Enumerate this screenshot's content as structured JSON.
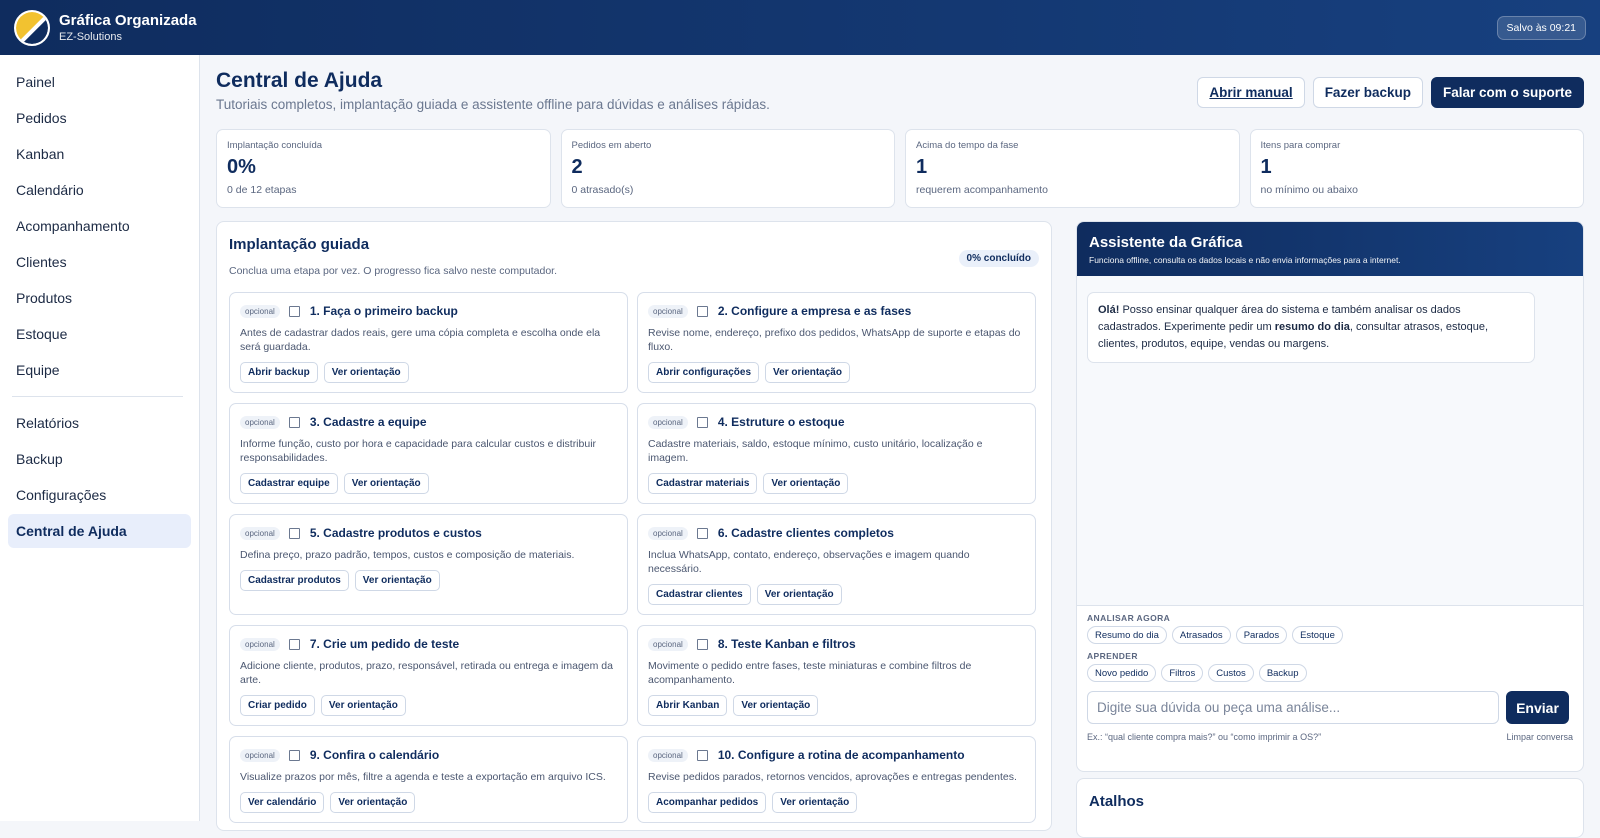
{
  "app": {
    "title": "Gráfica Organizada",
    "subtitle": "EZ-Solutions",
    "saved": "Salvo às 09:21"
  },
  "sidebar": {
    "items": [
      {
        "label": "Painel"
      },
      {
        "label": "Pedidos"
      },
      {
        "label": "Kanban"
      },
      {
        "label": "Calendário"
      },
      {
        "label": "Acompanhamento"
      },
      {
        "label": "Clientes"
      },
      {
        "label": "Produtos"
      },
      {
        "label": "Estoque"
      },
      {
        "label": "Equipe"
      },
      {
        "label": "Relatórios"
      },
      {
        "label": "Backup"
      },
      {
        "label": "Configurações"
      },
      {
        "label": "Central de Ajuda"
      }
    ]
  },
  "page": {
    "title": "Central de Ajuda",
    "subtitle": "Tutoriais completos, implantação guiada e assistente offline para dúvidas e análises rápidas.",
    "actions": {
      "manual": "Abrir manual",
      "backup": "Fazer backup",
      "support": "Falar com o suporte"
    }
  },
  "stats": [
    {
      "label": "Implantação concluída",
      "value": "0%",
      "note": "0 de 12 etapas"
    },
    {
      "label": "Pedidos em aberto",
      "value": "2",
      "note": "0 atrasado(s)"
    },
    {
      "label": "Acima do tempo da fase",
      "value": "1",
      "note": "requerem acompanhamento"
    },
    {
      "label": "Itens para comprar",
      "value": "1",
      "note": "no mínimo ou abaixo"
    }
  ],
  "guided": {
    "title": "Implantação guiada",
    "subtitle": "Conclua uma etapa por vez. O progresso fica salvo neste computador.",
    "progress": "0% concluído",
    "tag": "opcional",
    "steps": [
      {
        "title": "1. Faça o primeiro backup",
        "desc": "Antes de cadastrar dados reais, gere uma cópia completa e escolha onde ela será guardada.",
        "action": "Abrir backup",
        "guide": "Ver orientação"
      },
      {
        "title": "2. Configure a empresa e as fases",
        "desc": "Revise nome, endereço, prefixo dos pedidos, WhatsApp de suporte e etapas do fluxo.",
        "action": "Abrir configurações",
        "guide": "Ver orientação"
      },
      {
        "title": "3. Cadastre a equipe",
        "desc": "Informe função, custo por hora e capacidade para calcular custos e distribuir responsabilidades.",
        "action": "Cadastrar equipe",
        "guide": "Ver orientação"
      },
      {
        "title": "4. Estruture o estoque",
        "desc": "Cadastre materiais, saldo, estoque mínimo, custo unitário, localização e imagem.",
        "action": "Cadastrar materiais",
        "guide": "Ver orientação"
      },
      {
        "title": "5. Cadastre produtos e custos",
        "desc": "Defina preço, prazo padrão, tempos, custos e composição de materiais.",
        "action": "Cadastrar produtos",
        "guide": "Ver orientação"
      },
      {
        "title": "6. Cadastre clientes completos",
        "desc": "Inclua WhatsApp, contato, endereço, observações e imagem quando necessário.",
        "action": "Cadastrar clientes",
        "guide": "Ver orientação"
      },
      {
        "title": "7. Crie um pedido de teste",
        "desc": "Adicione cliente, produtos, prazo, responsável, retirada ou entrega e imagem da arte.",
        "action": "Criar pedido",
        "guide": "Ver orientação"
      },
      {
        "title": "8. Teste Kanban e filtros",
        "desc": "Movimente o pedido entre fases, teste miniaturas e combine filtros de acompanhamento.",
        "action": "Abrir Kanban",
        "guide": "Ver orientação"
      },
      {
        "title": "9. Confira o calendário",
        "desc": "Visualize prazos por mês, filtre a agenda e teste a exportação em arquivo ICS.",
        "action": "Ver calendário",
        "guide": "Ver orientação"
      },
      {
        "title": "10. Configure a rotina de acompanhamento",
        "desc": "Revise pedidos parados, retornos vencidos, aprovações e entregas pendentes.",
        "action": "Acompanhar pedidos",
        "guide": "Ver orientação"
      }
    ]
  },
  "assistant": {
    "title": "Assistente da Gráfica",
    "subtitle": "Funciona offline, consulta os dados locais e não envia informações para a internet.",
    "msg_hello": "Olá!",
    "msg_part1": " Posso ensinar qualquer área do sistema e também analisar os dados cadastrados. Experimente pedir um ",
    "msg_bold": "resumo do dia",
    "msg_part2": ", consultar atrasos, estoque, clientes, produtos, equipe, vendas ou margens.",
    "analyze_label": "ANALISAR AGORA",
    "analyze": [
      "Resumo do dia",
      "Atrasados",
      "Parados",
      "Estoque"
    ],
    "learn_label": "APRENDER",
    "learn": [
      "Novo pedido",
      "Filtros",
      "Custos",
      "Backup"
    ],
    "placeholder": "Digite sua dúvida ou peça uma análise...",
    "send": "Enviar",
    "hint": "Ex.: “qual cliente compra mais?” ou “como imprimir a OS?”",
    "clear": "Limpar conversa"
  },
  "shortcuts": {
    "title": "Atalhos"
  }
}
